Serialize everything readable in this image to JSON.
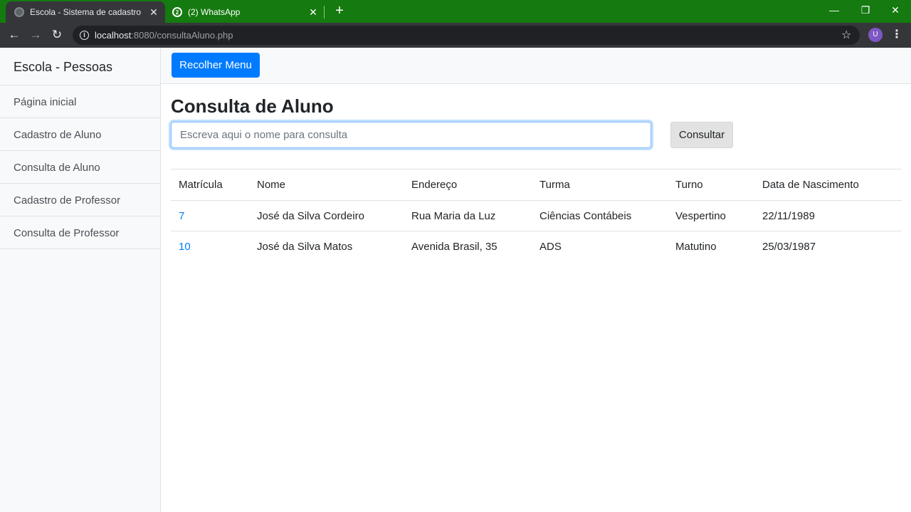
{
  "browser": {
    "tabs": [
      {
        "title": "Escola - Sistema de cadastro",
        "icon": "globe-icon",
        "active": true
      },
      {
        "title": "(2) WhatsApp",
        "icon": "whatsapp-icon",
        "active": false
      }
    ],
    "url_host": "localhost",
    "url_rest": ":8080/consultaAluno.php",
    "profile_initial": "U",
    "theme_color": "#157a0f"
  },
  "sidebar": {
    "heading": "Escola - Pessoas",
    "items": [
      {
        "label": "Página inicial"
      },
      {
        "label": "Cadastro de Aluno"
      },
      {
        "label": "Consulta de Aluno"
      },
      {
        "label": "Cadastro de Professor"
      },
      {
        "label": "Consulta de Professor"
      }
    ]
  },
  "topnav": {
    "toggle_label": "Recolher Menu"
  },
  "main": {
    "title": "Consulta de Aluno",
    "search": {
      "placeholder": "Escreva aqui o nome para consulta",
      "value": "",
      "button_label": "Consultar"
    },
    "table": {
      "headers": [
        "Matrícula",
        "Nome",
        "Endereço",
        "Turma",
        "Turno",
        "Data de Nascimento"
      ],
      "rows": [
        [
          "7",
          "José da Silva Cordeiro",
          "Rua Maria da Luz",
          "Ciências Contábeis",
          "Vespertino",
          "22/11/1989"
        ],
        [
          "10",
          "José da Silva Matos",
          "Avenida Brasil, 35",
          "ADS",
          "Matutino",
          "25/03/1987"
        ]
      ]
    }
  },
  "colors": {
    "primary": "#007bff",
    "link": "#007bff"
  }
}
